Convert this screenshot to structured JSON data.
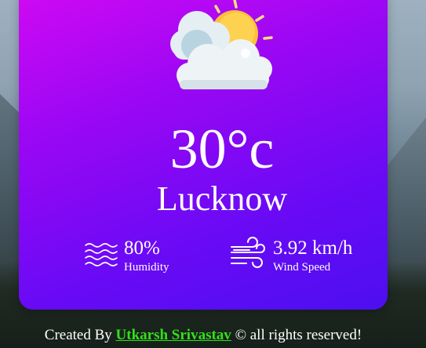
{
  "weather": {
    "icon": "partly-cloudy-icon",
    "temperature": "30°c",
    "city": "Lucknow"
  },
  "details": {
    "humidity_value": "80%",
    "humidity_label": "Humidity",
    "humidity_icon": "humidity-waves-icon",
    "wind_value": "3.92 km/h",
    "wind_label": "Wind Speed",
    "wind_icon": "wind-icon"
  },
  "footer": {
    "prefix": "Created By ",
    "author": "Utkarsh Srivastav",
    "suffix": " © all rights reserved!"
  },
  "colors": {
    "card_start": "#d309f3",
    "card_end": "#4c0ff0",
    "author_link": "#33e01a"
  }
}
